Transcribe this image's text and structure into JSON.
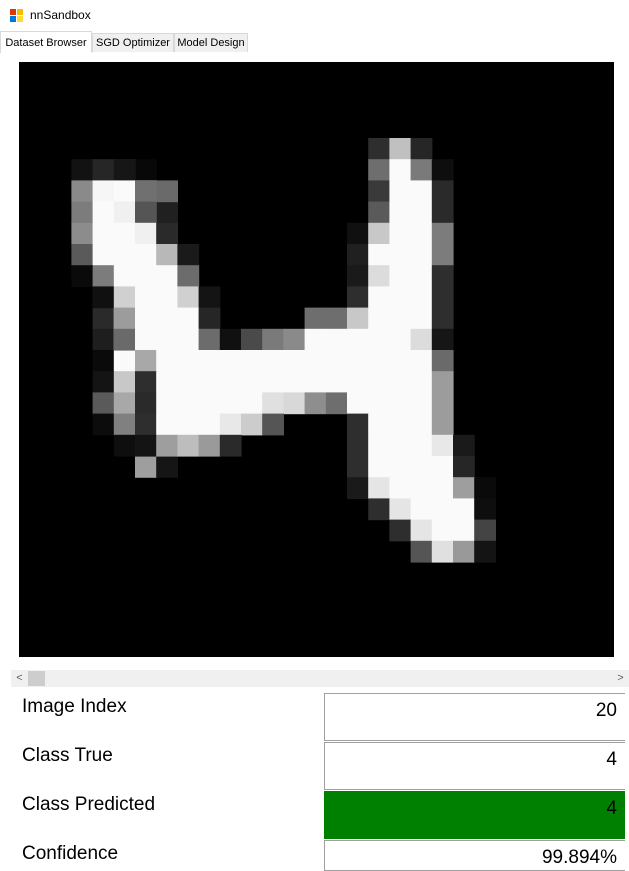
{
  "window": {
    "title": "nnSandbox",
    "icon": "app-window-icon"
  },
  "tabs": [
    {
      "label": "Dataset Browser",
      "active": true
    },
    {
      "label": "SGD Optimizer",
      "active": false
    },
    {
      "label": "Model Design",
      "active": false
    }
  ],
  "viewer": {
    "grid_size": 28,
    "background": "#000000",
    "image_index_shown": 20,
    "pixels": [
      [
        3,
        1,
        "#0e0e0e"
      ],
      [
        4,
        1,
        "#2e2e2e"
      ],
      [
        5,
        1,
        "#080808"
      ],
      [
        3,
        2,
        "#7a7a7a"
      ],
      [
        4,
        2,
        "#fafafa"
      ],
      [
        5,
        2,
        "#6e6e6e"
      ],
      [
        6,
        2,
        "#0a0a0a"
      ],
      [
        3,
        3,
        "#555555"
      ],
      [
        4,
        3,
        "#f0f0f0"
      ],
      [
        5,
        3,
        "#2a2a2a"
      ],
      [
        6,
        3,
        "#202020"
      ],
      [
        3,
        4,
        "#2a2a2a"
      ],
      [
        4,
        4,
        "#fafafa"
      ],
      [
        5,
        4,
        "#9a9a9a"
      ],
      [
        6,
        4,
        "#111111"
      ],
      [
        3,
        5,
        "#0a0a0a"
      ],
      [
        4,
        5,
        "#fafafa"
      ],
      [
        5,
        5,
        "#c8c8c8"
      ],
      [
        6,
        5,
        "#202020"
      ],
      [
        3,
        6,
        "#222222"
      ],
      [
        4,
        6,
        "#fafafa"
      ],
      [
        5,
        6,
        "#fafafa"
      ],
      [
        6,
        6,
        "#101010"
      ],
      [
        3,
        7,
        "#2e2e2e"
      ],
      [
        4,
        7,
        "#f0f0f0"
      ],
      [
        5,
        7,
        "#e0e0e0"
      ],
      [
        6,
        7,
        "#303030"
      ],
      [
        3,
        8,
        "#2a2a2a"
      ],
      [
        4,
        8,
        "#fafafa"
      ],
      [
        5,
        8,
        "#f5f5f5"
      ],
      [
        6,
        8,
        "#303030"
      ],
      [
        3,
        9,
        "#1e1e1e"
      ],
      [
        4,
        9,
        "#fafafa"
      ],
      [
        5,
        9,
        "#fafafa"
      ],
      [
        6,
        9,
        "#232323"
      ],
      [
        3,
        10,
        "#0a0a0a"
      ],
      [
        4,
        10,
        "#fafafa"
      ],
      [
        5,
        10,
        "#fafafa"
      ],
      [
        6,
        10,
        "#a0a0a0"
      ],
      [
        3,
        11,
        "#141414"
      ],
      [
        4,
        11,
        "#c8c8c8"
      ],
      [
        5,
        11,
        "#fafafa"
      ],
      [
        6,
        11,
        "#f0f0f0"
      ],
      [
        3,
        12,
        "#5a5a5a"
      ],
      [
        4,
        12,
        "#a8a8a8"
      ],
      [
        5,
        12,
        "#fafafa"
      ],
      [
        6,
        12,
        "#9e9e9e"
      ],
      [
        3,
        13,
        "#0c0c0c"
      ],
      [
        4,
        13,
        "#808080"
      ],
      [
        5,
        13,
        "#e5e5e5"
      ],
      [
        6,
        13,
        "#606060"
      ],
      [
        4,
        14,
        "#0e0e0e"
      ],
      [
        5,
        14,
        "#555555"
      ],
      [
        6,
        14,
        "#0a0a0a"
      ],
      [
        5,
        15,
        "#9e9e9e"
      ],
      [
        6,
        15,
        "#151515"
      ],
      [
        2,
        5,
        "#0e0e0e"
      ],
      [
        3,
        5,
        "#8e8e8e"
      ],
      [
        2,
        4,
        "#0a0a0a"
      ],
      [
        4,
        1,
        "#1a1a1a"
      ],
      [
        4,
        2,
        "#f8f8f8"
      ],
      [
        5,
        2,
        "#fefefe"
      ],
      [
        6,
        2,
        "#6a6a6a"
      ],
      [
        2,
        1,
        "#121212"
      ],
      [
        3,
        1,
        "#262626"
      ],
      [
        4,
        1,
        "#161616"
      ],
      [
        2,
        2,
        "#8a8a8a"
      ],
      [
        3,
        2,
        "#f6f6f6"
      ],
      [
        4,
        2,
        "#fafafa"
      ],
      [
        5,
        2,
        "#707070"
      ],
      [
        2,
        3,
        "#7c7c7c"
      ],
      [
        3,
        3,
        "#fafafa"
      ],
      [
        4,
        3,
        "#f0f0f0"
      ],
      [
        5,
        3,
        "#555555"
      ],
      [
        2,
        4,
        "#8c8c8c"
      ],
      [
        3,
        4,
        "#fafafa"
      ],
      [
        4,
        4,
        "#fafafa"
      ],
      [
        5,
        4,
        "#f0f0f0"
      ],
      [
        6,
        4,
        "#2a2a2a"
      ],
      [
        2,
        5,
        "#5a5a5a"
      ],
      [
        3,
        5,
        "#fafafa"
      ],
      [
        4,
        5,
        "#fafafa"
      ],
      [
        5,
        5,
        "#fafafa"
      ],
      [
        6,
        5,
        "#b8b8b8"
      ],
      [
        7,
        5,
        "#1a1a1a"
      ],
      [
        2,
        6,
        "#0a0a0a"
      ],
      [
        3,
        6,
        "#7c7c7c"
      ],
      [
        4,
        6,
        "#fafafa"
      ],
      [
        5,
        6,
        "#fafafa"
      ],
      [
        6,
        6,
        "#fafafa"
      ],
      [
        7,
        6,
        "#6c6c6c"
      ],
      [
        3,
        7,
        "#101010"
      ],
      [
        4,
        7,
        "#d0d0d0"
      ],
      [
        5,
        7,
        "#fafafa"
      ],
      [
        6,
        7,
        "#fafafa"
      ],
      [
        7,
        7,
        "#d0d0d0"
      ],
      [
        8,
        7,
        "#141414"
      ],
      [
        4,
        8,
        "#9c9c9c"
      ],
      [
        5,
        8,
        "#fafafa"
      ],
      [
        6,
        8,
        "#fafafa"
      ],
      [
        7,
        8,
        "#fafafa"
      ],
      [
        8,
        8,
        "#262626"
      ],
      [
        4,
        9,
        "#6a6a6a"
      ],
      [
        5,
        9,
        "#fafafa"
      ],
      [
        6,
        9,
        "#fafafa"
      ],
      [
        7,
        9,
        "#fafafa"
      ],
      [
        8,
        9,
        "#6c6c6c"
      ],
      [
        9,
        9,
        "#101010"
      ],
      [
        10,
        9,
        "#4a4a4a"
      ],
      [
        11,
        9,
        "#7a7a7a"
      ],
      [
        12,
        9,
        "#8a8a8a"
      ],
      [
        5,
        10,
        "#a8a8a8"
      ],
      [
        6,
        10,
        "#fafafa"
      ],
      [
        7,
        10,
        "#fafafa"
      ],
      [
        8,
        10,
        "#fafafa"
      ],
      [
        9,
        10,
        "#fafafa"
      ],
      [
        10,
        10,
        "#fafafa"
      ],
      [
        11,
        10,
        "#fafafa"
      ],
      [
        12,
        10,
        "#fafafa"
      ],
      [
        13,
        10,
        "#fafafa"
      ],
      [
        5,
        11,
        "#2e2e2e"
      ],
      [
        6,
        11,
        "#fafafa"
      ],
      [
        7,
        11,
        "#fafafa"
      ],
      [
        8,
        11,
        "#fafafa"
      ],
      [
        9,
        11,
        "#fafafa"
      ],
      [
        10,
        11,
        "#fafafa"
      ],
      [
        11,
        11,
        "#fafafa"
      ],
      [
        12,
        11,
        "#fafafa"
      ],
      [
        13,
        11,
        "#fafafa"
      ],
      [
        5,
        12,
        "#2a2a2a"
      ],
      [
        6,
        12,
        "#fafafa"
      ],
      [
        7,
        12,
        "#fafafa"
      ],
      [
        8,
        12,
        "#fafafa"
      ],
      [
        9,
        12,
        "#fafafa"
      ],
      [
        10,
        12,
        "#fafafa"
      ],
      [
        11,
        12,
        "#e0e0e0"
      ],
      [
        12,
        12,
        "#d8d8d8"
      ],
      [
        13,
        12,
        "#8e8e8e"
      ],
      [
        5,
        13,
        "#2e2e2e"
      ],
      [
        6,
        13,
        "#fafafa"
      ],
      [
        7,
        13,
        "#fafafa"
      ],
      [
        8,
        13,
        "#fafafa"
      ],
      [
        9,
        13,
        "#e8e8e8"
      ],
      [
        10,
        13,
        "#cccccc"
      ],
      [
        11,
        13,
        "#555555"
      ],
      [
        5,
        14,
        "#141414"
      ],
      [
        6,
        14,
        "#9e9e9e"
      ],
      [
        7,
        14,
        "#bdbdbd"
      ],
      [
        8,
        14,
        "#9a9a9a"
      ],
      [
        9,
        14,
        "#2a2a2a"
      ],
      [
        16,
        0,
        "#2e2e2e"
      ],
      [
        17,
        0,
        "#c0c0c0"
      ],
      [
        18,
        0,
        "#262626"
      ],
      [
        16,
        1,
        "#6e6e6e"
      ],
      [
        17,
        1,
        "#fafafa"
      ],
      [
        18,
        1,
        "#7a7a7a"
      ],
      [
        19,
        1,
        "#0e0e0e"
      ],
      [
        16,
        2,
        "#3a3a3a"
      ],
      [
        17,
        2,
        "#fafafa"
      ],
      [
        18,
        2,
        "#fafafa"
      ],
      [
        19,
        2,
        "#2a2a2a"
      ],
      [
        16,
        3,
        "#5a5a5a"
      ],
      [
        17,
        3,
        "#fafafa"
      ],
      [
        18,
        3,
        "#fafafa"
      ],
      [
        19,
        3,
        "#2a2a2a"
      ],
      [
        15,
        4,
        "#101010"
      ],
      [
        16,
        4,
        "#c8c8c8"
      ],
      [
        17,
        4,
        "#fafafa"
      ],
      [
        18,
        4,
        "#fafafa"
      ],
      [
        19,
        4,
        "#7c7c7c"
      ],
      [
        15,
        5,
        "#202020"
      ],
      [
        16,
        5,
        "#fafafa"
      ],
      [
        17,
        5,
        "#fafafa"
      ],
      [
        18,
        5,
        "#fafafa"
      ],
      [
        19,
        5,
        "#7c7c7c"
      ],
      [
        15,
        6,
        "#1a1a1a"
      ],
      [
        16,
        6,
        "#dcdcdc"
      ],
      [
        17,
        6,
        "#fafafa"
      ],
      [
        18,
        6,
        "#fafafa"
      ],
      [
        19,
        6,
        "#2e2e2e"
      ],
      [
        15,
        7,
        "#2e2e2e"
      ],
      [
        16,
        7,
        "#fafafa"
      ],
      [
        17,
        7,
        "#fafafa"
      ],
      [
        18,
        7,
        "#fafafa"
      ],
      [
        19,
        7,
        "#2e2e2e"
      ],
      [
        13,
        8,
        "#6e6e6e"
      ],
      [
        14,
        8,
        "#6e6e6e"
      ],
      [
        15,
        8,
        "#c8c8c8"
      ],
      [
        16,
        8,
        "#fafafa"
      ],
      [
        17,
        8,
        "#fafafa"
      ],
      [
        18,
        8,
        "#fafafa"
      ],
      [
        19,
        8,
        "#2e2e2e"
      ],
      [
        13,
        9,
        "#fafafa"
      ],
      [
        14,
        9,
        "#fafafa"
      ],
      [
        15,
        9,
        "#fafafa"
      ],
      [
        16,
        9,
        "#fafafa"
      ],
      [
        17,
        9,
        "#fafafa"
      ],
      [
        18,
        9,
        "#dcdcdc"
      ],
      [
        19,
        9,
        "#161616"
      ],
      [
        14,
        10,
        "#fafafa"
      ],
      [
        15,
        10,
        "#fafafa"
      ],
      [
        16,
        10,
        "#fafafa"
      ],
      [
        17,
        10,
        "#fafafa"
      ],
      [
        18,
        10,
        "#fafafa"
      ],
      [
        19,
        10,
        "#6a6a6a"
      ],
      [
        14,
        11,
        "#fafafa"
      ],
      [
        15,
        11,
        "#fafafa"
      ],
      [
        16,
        11,
        "#fafafa"
      ],
      [
        17,
        11,
        "#fafafa"
      ],
      [
        18,
        11,
        "#fafafa"
      ],
      [
        19,
        11,
        "#9c9c9c"
      ],
      [
        14,
        12,
        "#6e6e6e"
      ],
      [
        15,
        12,
        "#fafafa"
      ],
      [
        16,
        12,
        "#fafafa"
      ],
      [
        17,
        12,
        "#fafafa"
      ],
      [
        18,
        12,
        "#fafafa"
      ],
      [
        19,
        12,
        "#9c9c9c"
      ],
      [
        15,
        13,
        "#2e2e2e"
      ],
      [
        16,
        13,
        "#fafafa"
      ],
      [
        17,
        13,
        "#fafafa"
      ],
      [
        18,
        13,
        "#fafafa"
      ],
      [
        19,
        13,
        "#9c9c9c"
      ],
      [
        15,
        14,
        "#2e2e2e"
      ],
      [
        16,
        14,
        "#fafafa"
      ],
      [
        17,
        14,
        "#fafafa"
      ],
      [
        18,
        14,
        "#fafafa"
      ],
      [
        19,
        14,
        "#e8e8e8"
      ],
      [
        20,
        14,
        "#1a1a1a"
      ],
      [
        15,
        15,
        "#2e2e2e"
      ],
      [
        16,
        15,
        "#fafafa"
      ],
      [
        17,
        15,
        "#fafafa"
      ],
      [
        18,
        15,
        "#fafafa"
      ],
      [
        19,
        15,
        "#fafafa"
      ],
      [
        20,
        15,
        "#262626"
      ],
      [
        15,
        16,
        "#1a1a1a"
      ],
      [
        16,
        16,
        "#e5e5e5"
      ],
      [
        17,
        16,
        "#fafafa"
      ],
      [
        18,
        16,
        "#fafafa"
      ],
      [
        19,
        16,
        "#fafafa"
      ],
      [
        20,
        16,
        "#9e9e9e"
      ],
      [
        21,
        16,
        "#0a0a0a"
      ],
      [
        16,
        17,
        "#2e2e2e"
      ],
      [
        17,
        17,
        "#e5e5e5"
      ],
      [
        18,
        17,
        "#fafafa"
      ],
      [
        19,
        17,
        "#fafafa"
      ],
      [
        20,
        17,
        "#fafafa"
      ],
      [
        21,
        17,
        "#0e0e0e"
      ],
      [
        17,
        18,
        "#2e2e2e"
      ],
      [
        18,
        18,
        "#e5e5e5"
      ],
      [
        19,
        18,
        "#fafafa"
      ],
      [
        20,
        18,
        "#fafafa"
      ],
      [
        21,
        18,
        "#444444"
      ],
      [
        18,
        19,
        "#555555"
      ],
      [
        19,
        19,
        "#e0e0e0"
      ],
      [
        20,
        19,
        "#999999"
      ],
      [
        21,
        19,
        "#141414"
      ]
    ]
  },
  "scrollbar": {
    "left_arrow": "<",
    "right_arrow": ">",
    "position": 0
  },
  "properties": [
    {
      "label": "Image Index",
      "value": "20",
      "highlight": ""
    },
    {
      "label": "Class True",
      "value": "4",
      "highlight": ""
    },
    {
      "label": "Class Predicted",
      "value": "4",
      "highlight": "#008000"
    },
    {
      "label": "Confidence",
      "value": "99.894%",
      "highlight": ""
    }
  ]
}
